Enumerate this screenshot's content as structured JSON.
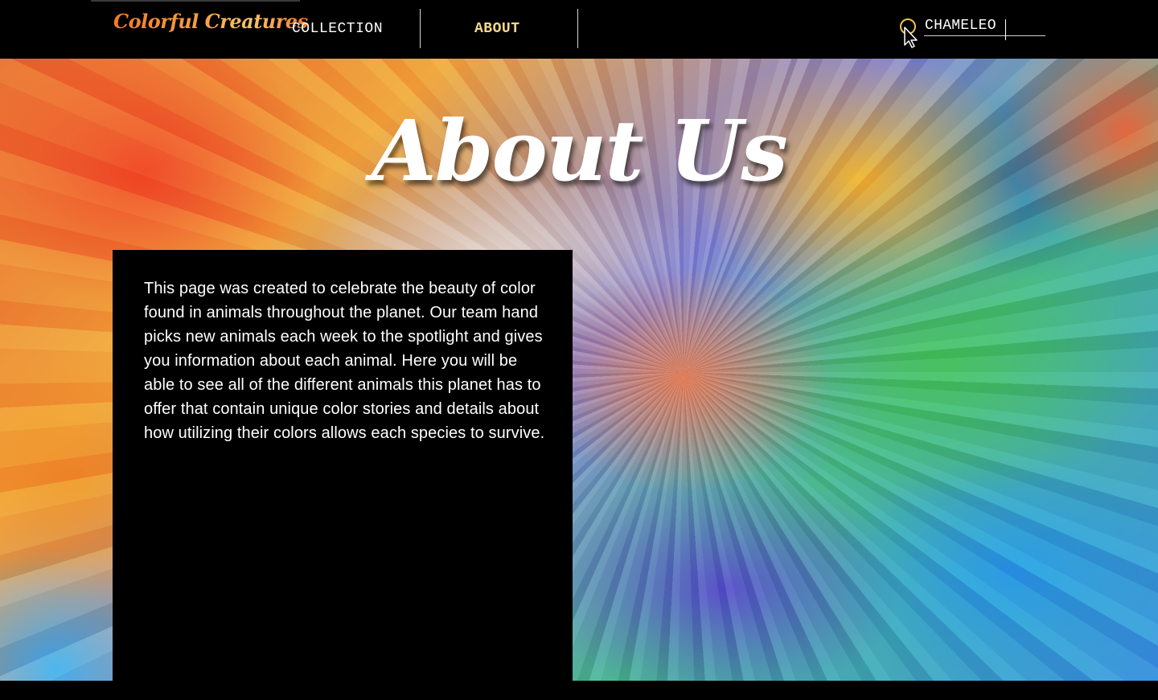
{
  "header": {
    "logo": "Colorful Creatures",
    "nav": [
      {
        "label": "COLLECTION",
        "active": false
      },
      {
        "label": "ABOUT",
        "active": true
      }
    ],
    "search": {
      "value": "CHAMELEO",
      "icon": "search-icon"
    }
  },
  "main": {
    "title": "About Us",
    "about_text": "This page was created to celebrate the beauty of color found in animals throughout the planet. Our team hand picks new animals each week to the spotlight and gives you information about each animal. Here you will be able to see all of the different animals this planet has to offer that contain unique color stories and details about how utilizing their colors allows each species to survive."
  },
  "colors": {
    "background": "#000000",
    "nav_active": "#f3d98a",
    "logo_gradient": [
      "#f07a2a",
      "#f8c36a"
    ],
    "text": "#ffffff"
  }
}
